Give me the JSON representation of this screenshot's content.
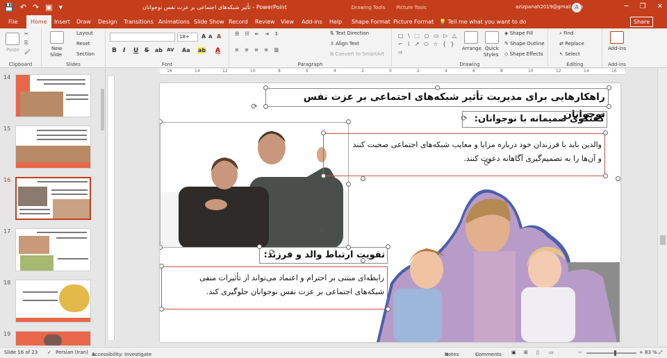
{
  "window": {
    "doc_title": "تأثیر شبکه‌های اجتماعی بر عزت نفس نوجوانان  -  PowerPoint",
    "context_tabs": [
      "Drawing Tools",
      "Picture Tools"
    ],
    "user_email": "azizpanah2019@gmail.com",
    "user_initial": "A",
    "minimize": "─",
    "restore": "❐",
    "close": "✕"
  },
  "qat": {
    "save_icon": "💾",
    "undo_icon": "↶",
    "redo_icon": "↷",
    "present_icon": "▣",
    "more_icon": "▾"
  },
  "tabs": [
    {
      "label": "File"
    },
    {
      "label": "Home"
    },
    {
      "label": "Insert"
    },
    {
      "label": "Draw"
    },
    {
      "label": "Design"
    },
    {
      "label": "Transitions"
    },
    {
      "label": "Animations"
    },
    {
      "label": "Slide Show"
    },
    {
      "label": "Record"
    },
    {
      "label": "Review"
    },
    {
      "label": "View"
    },
    {
      "label": "Add-ins"
    },
    {
      "label": "Help"
    },
    {
      "label": "Shape Format"
    },
    {
      "label": "Picture Format"
    }
  ],
  "tell_me": "Tell me what you want to do",
  "share": "Share",
  "ribbon": {
    "clipboard": {
      "label": "Clipboard",
      "paste": "Paste"
    },
    "slides": {
      "label": "Slides",
      "new_slide": "New",
      "new_slide2": "Slide",
      "layout": "Layout",
      "reset": "Reset",
      "section": "Section"
    },
    "font": {
      "label": "Font",
      "font_name": "",
      "font_size": "18+",
      "bold": "B",
      "italic": "I",
      "underline": "U",
      "strike": "S",
      "shadow": "ab",
      "spacing": "AV",
      "case": "Aa",
      "grow": "A",
      "shrink": "A",
      "clear": "A",
      "highlight": "ab",
      "font_color": "A"
    },
    "paragraph": {
      "label": "Paragraph",
      "text_direction": "Text Direction",
      "align_text": "Align Text",
      "smartart": "Convert to SmartArt"
    },
    "drawing": {
      "label": "Drawing",
      "shapes": "□ \\ ⬚ ○ ▭ ▷ △ ⌐ ⌇ ↗ ⬭ ☆ { } ⇨",
      "arrange": "Arrange",
      "quick_styles": "Quick",
      "quick_styles2": "Styles",
      "shape_fill": "Shape Fill",
      "shape_outline": "Shape Outline",
      "shape_effects": "Shape Effects"
    },
    "editing": {
      "label": "Editing",
      "find": "Find",
      "replace": "Replace",
      "select": "Select"
    },
    "addins": {
      "label": "Add-ins",
      "addins": "Add-ins"
    }
  },
  "ruler_numbers": [
    "16",
    "14",
    "12",
    "10",
    "8",
    "6",
    "4",
    "2",
    "0",
    "2",
    "4",
    "6",
    "8",
    "10",
    "12",
    "14",
    "16"
  ],
  "thumbnails": [
    {
      "num": "14"
    },
    {
      "num": "15"
    },
    {
      "num": "16"
    },
    {
      "num": "17"
    },
    {
      "num": "18"
    },
    {
      "num": "19"
    }
  ],
  "slide": {
    "title": "راهکارهایی برای مدیریت تأثیر شبکه‌های اجتماعی بر عزت نفس نوجوانان",
    "heading1": "گفتگوی صمیمانه با نوجوانان:",
    "para1_line1": "والدین باید با فرزندان خود درباره مزایا و معایب شبکه‌های اجتماعی صحبت کنند",
    "para1_line2": "و آن‌ها را به تصمیم‌گیری آگاهانه دعوت کنند.",
    "heading2": "تقویت ارتباط والد و فرزند:",
    "para2_line1": "رابطه‌ای مبتنی بر احترام و اعتماد می‌تواند از تأثیرات منفی",
    "para2_line2": "شبکه‌های اجتماعی بر عزت نفس نوجوانان جلوگیری کند."
  },
  "status": {
    "slide_of": "Slide 16 of 23",
    "language": "Persian (Iran)",
    "accessibility": "Accessibility: Investigate",
    "notes": "Notes",
    "comments": "Comments",
    "zoom": "83 %"
  }
}
